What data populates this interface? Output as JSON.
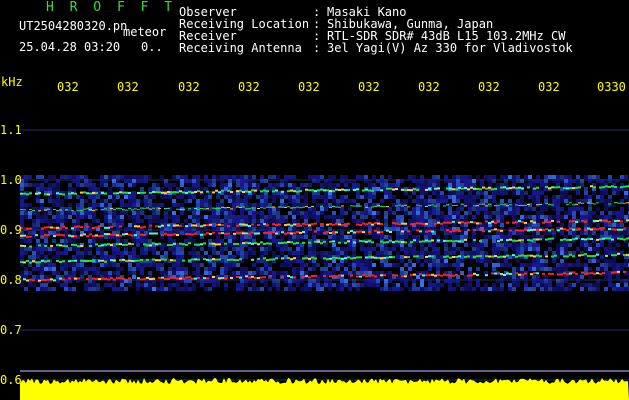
{
  "header": {
    "title": "H R O F F T",
    "file_name": "UT2504280320.pn",
    "detect_type": "meteor",
    "date_time": "25.04.28 03:20",
    "count": "0..",
    "fields": [
      {
        "label": "Observer",
        "value": "Masaki Kano"
      },
      {
        "label": "Receiving Location",
        "value": "Shibukawa, Gunma, Japan"
      },
      {
        "label": "Receiver",
        "value": "RTL-SDR SDR# 43dB L15 103.2MHz CW"
      },
      {
        "label": "Receiving Antenna",
        "value": "3el Yagi(V) Az 330 for Vladivostok"
      }
    ],
    "separator": ":"
  },
  "plot": {
    "y_unit": "kHz",
    "y_ticks": [
      "1.1",
      "1.0",
      "0.9",
      "0.8",
      "0.7",
      "0.6"
    ],
    "x_ticks": [
      "032",
      "032",
      "032",
      "032",
      "032",
      "032",
      "032",
      "032",
      "032",
      "0330"
    ],
    "colors": {
      "background": "#000000",
      "noise": "#1a1aa0",
      "band": "#ffff00",
      "signal_strong": "#ff2020",
      "signal_mid": "#20e040"
    }
  }
}
